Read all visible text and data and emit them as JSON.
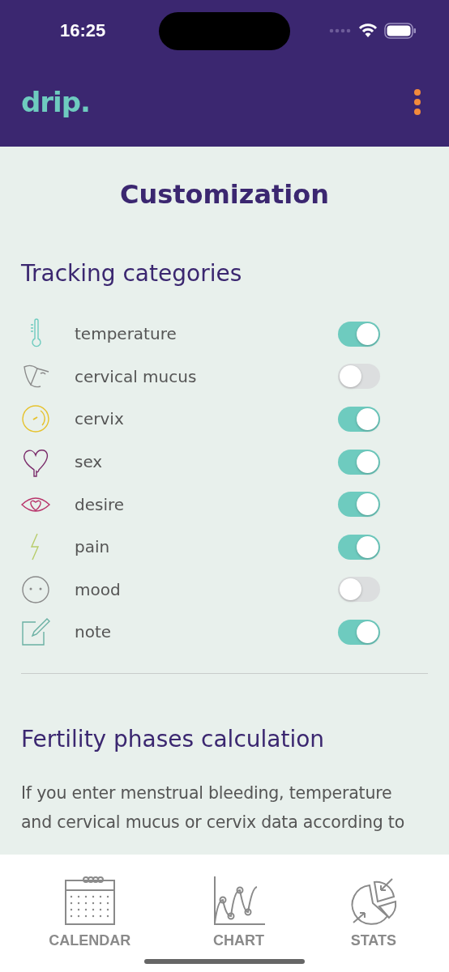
{
  "status_bar": {
    "time": "16:25"
  },
  "header": {
    "logo": "drip."
  },
  "page": {
    "title": "Customization"
  },
  "tracking": {
    "heading": "Tracking categories",
    "items": [
      {
        "label": "temperature",
        "on": true
      },
      {
        "label": "cervical mucus",
        "on": false
      },
      {
        "label": "cervix",
        "on": true
      },
      {
        "label": "sex",
        "on": true
      },
      {
        "label": "desire",
        "on": true
      },
      {
        "label": "pain",
        "on": true
      },
      {
        "label": "mood",
        "on": false
      },
      {
        "label": "note",
        "on": true
      }
    ]
  },
  "fertility": {
    "heading": "Fertility phases calculation",
    "text": "If you enter menstrual bleeding, temperature and cervical mucus or cervix data according to"
  },
  "tab_bar": {
    "tabs": [
      {
        "label": "CALENDAR"
      },
      {
        "label": "CHART"
      },
      {
        "label": "STATS"
      }
    ]
  }
}
